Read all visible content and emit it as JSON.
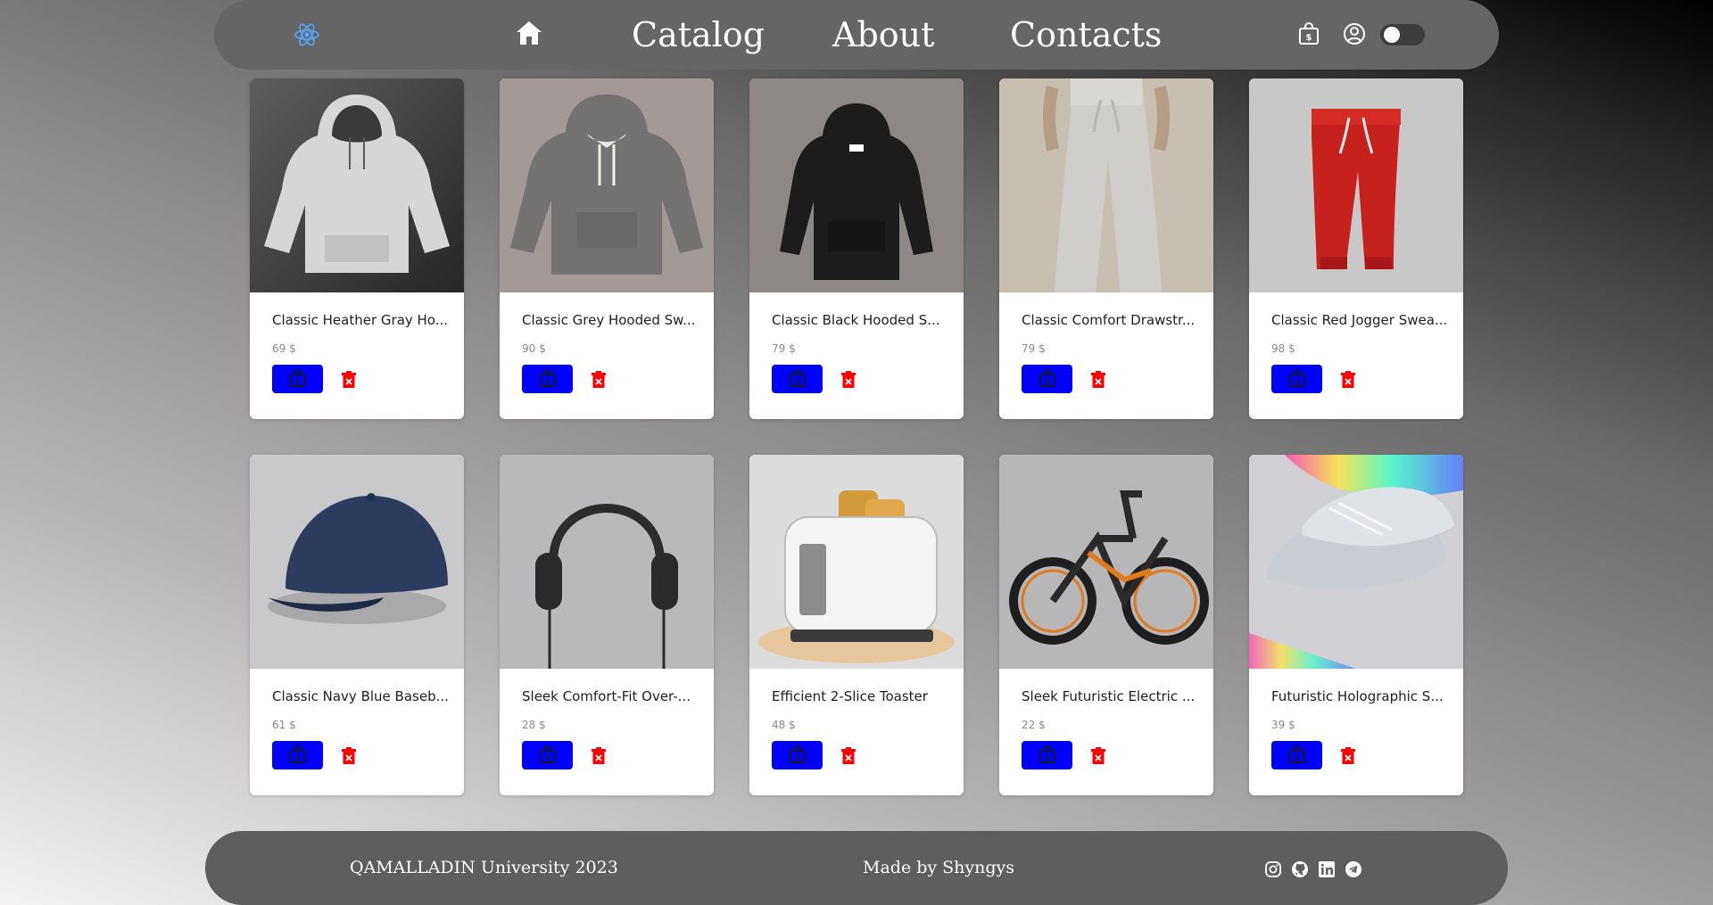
{
  "header": {
    "nav": {
      "home_icon": "home-icon",
      "catalog": "Catalog",
      "about": "About",
      "contacts": "Contacts"
    },
    "icons": [
      "atom-logo-icon",
      "shopping-bag-icon",
      "user-circle-icon"
    ],
    "theme_toggle": {
      "checked": false
    }
  },
  "products": [
    {
      "title": "Classic Heather Gray Ho...",
      "price": "69 $",
      "image": "light-gray-hoodie"
    },
    {
      "title": "Classic Grey Hooded Sw...",
      "price": "90 $",
      "image": "gray-hoodie"
    },
    {
      "title": "Classic Black Hooded S...",
      "price": "79 $",
      "image": "black-hoodie"
    },
    {
      "title": "Classic Comfort Drawstr...",
      "price": "79 $",
      "image": "beige-sweatpants"
    },
    {
      "title": "Classic Red Jogger Swea...",
      "price": "98 $",
      "image": "red-joggers"
    },
    {
      "title": "Classic Navy Blue Baseb...",
      "price": "61 $",
      "image": "navy-cap"
    },
    {
      "title": "Sleek Comfort-Fit Over-...",
      "price": "28 $",
      "image": "headphones"
    },
    {
      "title": "Efficient 2-Slice Toaster",
      "price": "48 $",
      "image": "toaster"
    },
    {
      "title": "Sleek Futuristic Electric ...",
      "price": "22 $",
      "image": "electric-bike"
    },
    {
      "title": "Futuristic Holographic S...",
      "price": "39 $",
      "image": "holographic-sneakers"
    }
  ],
  "colors": {
    "buy_button": "#0000ff",
    "delete_icon": "#ff0000",
    "header_bg": "#656565",
    "footer_bg": "#5e5e5e"
  },
  "footer": {
    "left": "QAMALLADIN University 2023",
    "middle": "Made by Shyngys",
    "social_icons": [
      "instagram-icon",
      "github-icon",
      "linkedin-icon",
      "telegram-icon"
    ]
  }
}
